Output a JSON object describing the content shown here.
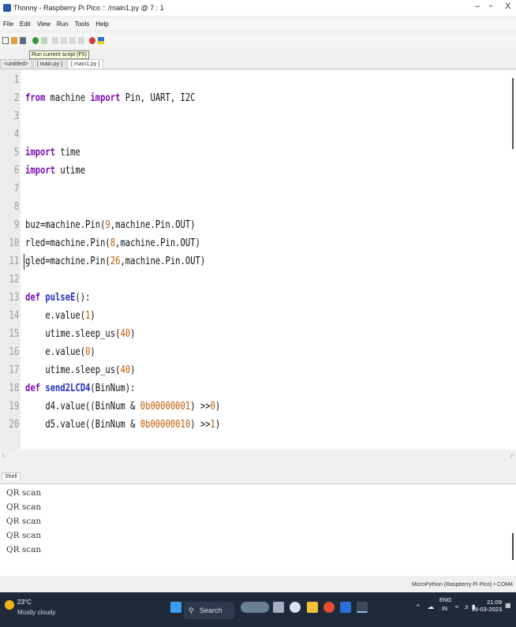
{
  "window": {
    "title": "Thonny - Raspberry Pi Pico :: /main1.py @ 7 : 1",
    "min": "–",
    "max": "▫",
    "close": "X"
  },
  "menu": [
    "File",
    "Edit",
    "View",
    "Run",
    "Tools",
    "Help"
  ],
  "tooltip": "Run current script (F5)",
  "tabs": [
    "<untitled>",
    "[ main.py ]",
    "[ main1.py ]"
  ],
  "editor": {
    "lines": [
      {
        "n": "1",
        "c": ""
      },
      {
        "n": "2",
        "c": "from machine import Pin, UART, I2C"
      },
      {
        "n": "3",
        "c": ""
      },
      {
        "n": "4",
        "c": ""
      },
      {
        "n": "5",
        "c": "import time"
      },
      {
        "n": "6",
        "c": "import utime"
      },
      {
        "n": "7",
        "c": ""
      },
      {
        "n": "8",
        "c": ""
      },
      {
        "n": "9",
        "c": "buz=machine.Pin(9,machine.Pin.OUT)"
      },
      {
        "n": "10",
        "c": "rled=machine.Pin(8,machine.Pin.OUT)"
      },
      {
        "n": "11",
        "c": "gled=machine.Pin(26,machine.Pin.OUT)"
      },
      {
        "n": "12",
        "c": ""
      },
      {
        "n": "13",
        "c": "def pulseE():"
      },
      {
        "n": "14",
        "c": "    e.value(1)"
      },
      {
        "n": "15",
        "c": "    utime.sleep_us(40)"
      },
      {
        "n": "16",
        "c": "    e.value(0)"
      },
      {
        "n": "17",
        "c": "    utime.sleep_us(40)"
      },
      {
        "n": "18",
        "c": "def send2LCD4(BinNum):"
      },
      {
        "n": "19",
        "c": "    d4.value((BinNum & 0b00000001) >>0)"
      },
      {
        "n": "20",
        "c": "    d5.value((BinNum & 0b00000010) >>1)"
      }
    ]
  },
  "shell": {
    "tab": "Shell",
    "lines": [
      "QR scan",
      "QR scan",
      "QR scan",
      "QR scan",
      "QR scan"
    ]
  },
  "status": "MicroPython (Raspberry Pi Pico) • COM4",
  "taskbar": {
    "temp": "23°C",
    "weather": "Mostly cloudy",
    "search": "Search",
    "lang1": "ENG",
    "lang2": "IN",
    "time": "21:09",
    "date": "19-03-2023"
  }
}
